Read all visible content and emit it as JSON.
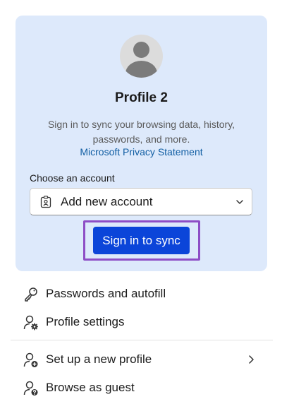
{
  "profile": {
    "name": "Profile 2",
    "description": "Sign in to sync your browsing data, history, passwords, and more.",
    "privacy_link": "Microsoft Privacy Statement",
    "choose_label": "Choose an account",
    "account_selected": "Add new account",
    "sync_button": "Sign in to sync"
  },
  "menu": {
    "items": [
      {
        "label": "Passwords and autofill",
        "icon": "key-icon"
      },
      {
        "label": "Profile settings",
        "icon": "profile-settings-icon"
      },
      {
        "label": "Set up a new profile",
        "icon": "add-profile-icon"
      },
      {
        "label": "Browse as guest",
        "icon": "guest-profile-icon"
      }
    ]
  },
  "colors": {
    "card_background": "#dde9fb",
    "primary_button": "#0b45d9",
    "highlight_border": "#8e4ec6",
    "link": "#115ea3"
  }
}
